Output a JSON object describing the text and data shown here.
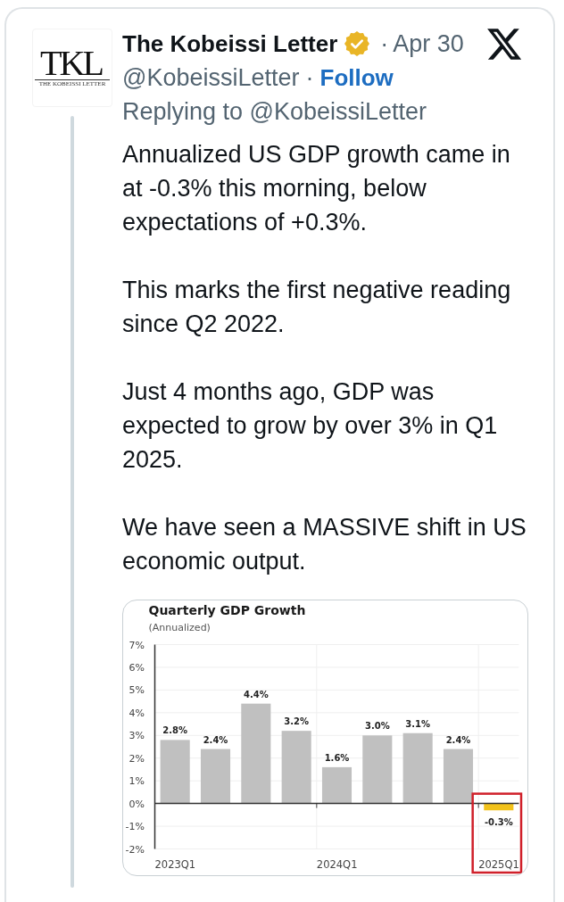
{
  "tweet": {
    "avatar": {
      "logo_text": "TKL",
      "logo_subtitle": "THE KOBEISSI LETTER"
    },
    "author": {
      "name": "The Kobeissi Letter",
      "verified": true,
      "date_separator": "·",
      "date": "Apr 30",
      "handle": "@KobeissiLetter",
      "follow_separator": "·",
      "follow": "Follow"
    },
    "replying_to": "Replying to @KobeissiLetter",
    "paragraphs": [
      "Annualized US GDP growth came in at -0.3% this morning, below expectations of +0.3%.",
      "This marks the first negative reading since Q2 2022.",
      "Just 4 months ago, GDP was expected to grow by over 3% in Q1 2025.",
      "We have seen a MASSIVE shift in US economic output."
    ],
    "media": {
      "chart_data": {
        "type": "bar",
        "title": "Quarterly GDP Growth",
        "subtitle": "(Annualized)",
        "categories": [
          "2023Q1",
          null,
          null,
          null,
          "2024Q1",
          null,
          null,
          null,
          "2025Q1"
        ],
        "ylim": [
          -2,
          7
        ],
        "yticks": [
          {
            "value": -2,
            "label": "-2%"
          },
          {
            "value": -1,
            "label": "-1%"
          },
          {
            "value": 0,
            "label": "0%"
          },
          {
            "value": 1,
            "label": "1%"
          },
          {
            "value": 2,
            "label": "2%"
          },
          {
            "value": 3,
            "label": "3%"
          },
          {
            "value": 4,
            "label": "4%"
          },
          {
            "value": 5,
            "label": "5%"
          },
          {
            "value": 6,
            "label": "6%"
          },
          {
            "value": 7,
            "label": "7%"
          }
        ],
        "grid": true,
        "stacked": true,
        "series": [
          {
            "color": "#c0c0c0",
            "values": [
              2.8,
              2.4,
              4.4,
              3.2,
              1.6,
              3.0,
              3.1,
              2.4,
              null
            ]
          },
          {
            "color": "#f2c21b",
            "values": [
              null,
              null,
              null,
              null,
              null,
              null,
              null,
              null,
              -0.3
            ]
          }
        ],
        "value_labels": [
          "2.8%",
          "2.4%",
          "4.4%",
          "3.2%",
          "1.6%",
          "3.0%",
          "3.1%",
          "2.4%",
          "-0.3%"
        ]
      },
      "latest_bar_boxed": true
    }
  }
}
